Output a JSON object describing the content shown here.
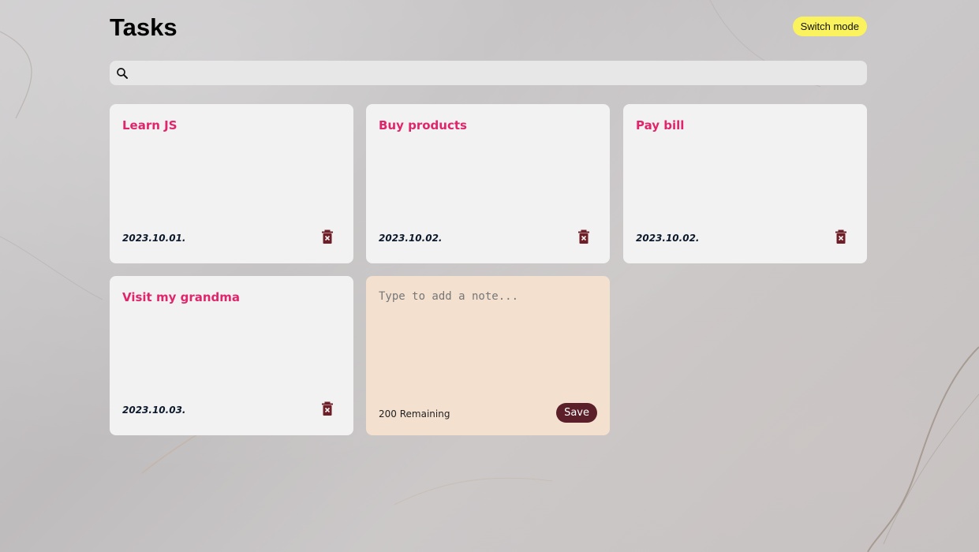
{
  "header": {
    "title": "Tasks",
    "switch_mode_label": "Switch mode"
  },
  "search": {
    "value": "",
    "placeholder": "",
    "icon": "search-icon"
  },
  "notes": [
    {
      "title": "Learn JS",
      "date": "2023.10.01."
    },
    {
      "title": "Buy products",
      "date": "2023.10.02."
    },
    {
      "title": "Pay bill",
      "date": "2023.10.02."
    },
    {
      "title": "Visit my grandma",
      "date": "2023.10.03."
    }
  ],
  "new_note": {
    "placeholder": "Type to add a note...",
    "remaining_label": "200 Remaining",
    "save_label": "Save"
  },
  "colors": {
    "accent_title": "#e0256b",
    "switch_button": "#fbf35d",
    "save_button": "#5b1f29",
    "delete_icon": "#6e1e27",
    "new_note_bg": "#f3e0cf"
  }
}
